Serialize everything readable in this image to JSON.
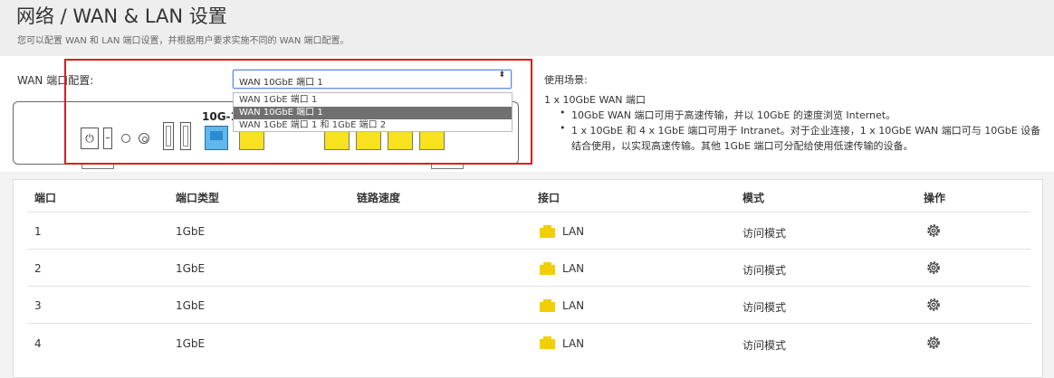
{
  "header": {
    "title": "网络 / WAN & LAN 设置",
    "subtitle": "您可以配置 WAN 和 LAN 端口设置，并根据用户要求实施不同的 WAN 端口配置。"
  },
  "wan_config": {
    "label": "WAN 端口配置:",
    "selected": "WAN 10GbE 端口 1",
    "arrow": "⬍",
    "options": [
      "WAN 1GbE 端口 1",
      "WAN 10GbE 端口 1",
      "WAN 1GbE 端口 1 和 1GbE 端口 2"
    ],
    "selected_option_index": 1
  },
  "device": {
    "power_symbol": "⏻",
    "port_10g_label": "10G-1",
    "port_colors": {
      "wan10g": "#5fb7ec",
      "lan": "#f8e11f"
    }
  },
  "usage": {
    "title": "使用场景:",
    "scenario": "1 x 10GbE WAN 端口",
    "bullets": [
      [
        "10GbE WAN 端口可用于高速传输，并以 10GbE 的速度浏览 Internet。"
      ],
      [
        "1 x 10GbE 和 4 x 1GbE 端口可用于 Intranet。对于企业连接，1 x 10GbE WAN 端口可与 10GbE 设备",
        "结合使用，以实现高速传输。其他 1GbE 端口可分配给使用低速传输的设备。"
      ]
    ]
  },
  "table": {
    "headers": [
      "端口",
      "端口类型",
      "链路速度",
      "接口",
      "模式",
      "操作"
    ],
    "rows": [
      {
        "port": "1",
        "type": "1GbE",
        "speed": "",
        "interface": "LAN",
        "mode": "访问模式"
      },
      {
        "port": "2",
        "type": "1GbE",
        "speed": "",
        "interface": "LAN",
        "mode": "访问模式"
      },
      {
        "port": "3",
        "type": "1GbE",
        "speed": "",
        "interface": "LAN",
        "mode": "访问模式"
      },
      {
        "port": "4",
        "type": "1GbE",
        "speed": "",
        "interface": "LAN",
        "mode": "访问模式"
      }
    ]
  },
  "colors": {
    "highlight": "#d62020",
    "lan_icon": "#f2cf00",
    "selected_option_bg": "#707070"
  }
}
